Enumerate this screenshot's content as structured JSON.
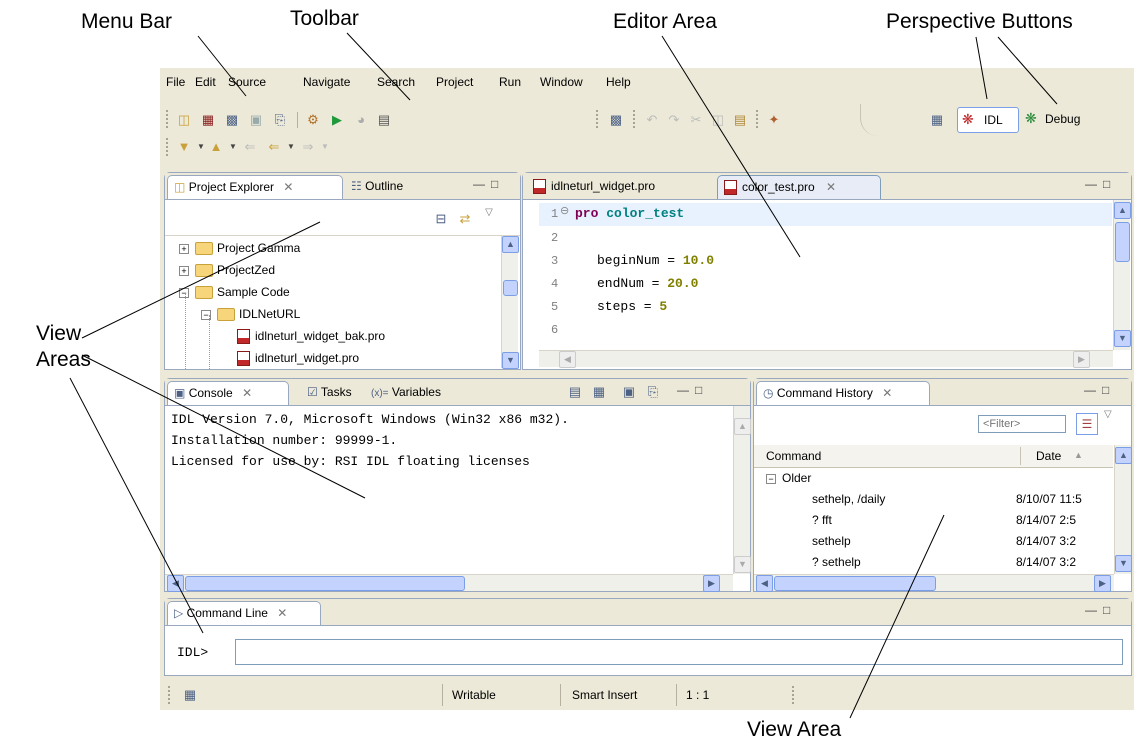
{
  "callouts": {
    "menu_bar": "Menu Bar",
    "toolbar": "Toolbar",
    "editor_area": "Editor Area",
    "perspective_buttons": "Perspective Buttons",
    "view_areas_line1": "View",
    "view_areas_line2": "Areas",
    "view_area": "View Area"
  },
  "menu": [
    "File",
    "Edit",
    "Source",
    "Navigate",
    "Search",
    "Project",
    "Run",
    "Window",
    "Help"
  ],
  "perspectives": {
    "idl": "IDL",
    "debug": "Debug"
  },
  "project_explorer": {
    "tabs": {
      "explorer": "Project Explorer",
      "outline": "Outline"
    },
    "tree": [
      {
        "label": "Project Gamma",
        "expander": "+"
      },
      {
        "label": "ProjectZed",
        "expander": "+"
      },
      {
        "label": "Sample Code",
        "expander": "−"
      },
      {
        "label": "IDLNetURL",
        "expander": "−"
      },
      {
        "label": "idlneturl_widget_bak.pro"
      },
      {
        "label": "idlneturl_widget.pro"
      }
    ]
  },
  "editor": {
    "tabs": {
      "tab1": "idlneturl_widget.pro",
      "tab2": "color_test.pro"
    },
    "lines": [
      {
        "num": "1",
        "kw": "pro",
        "rest": "color_test"
      },
      {
        "num": "2"
      },
      {
        "num": "3",
        "text": "beginNum = ",
        "val": "10.0"
      },
      {
        "num": "4",
        "text": "endNum = ",
        "val": "20.0"
      },
      {
        "num": "5",
        "text": "steps = ",
        "val": "5"
      },
      {
        "num": "6"
      }
    ]
  },
  "console": {
    "tabs": {
      "console": "Console",
      "tasks": "Tasks",
      "variables": "Variables"
    },
    "lines": [
      "IDL Version 7.0, Microsoft Windows (Win32 x86 m32).",
      "Installation number: 99999-1.",
      "Licensed for use by: RSI IDL floating licenses"
    ]
  },
  "history": {
    "tab": "Command History",
    "filter_placeholder": "<Filter>",
    "columns": {
      "command": "Command",
      "date": "Date"
    },
    "group": "Older",
    "rows": [
      {
        "command": "sethelp, /daily",
        "date": "8/10/07 11:5"
      },
      {
        "command": "? fft",
        "date": "8/14/07 2:5"
      },
      {
        "command": "sethelp",
        "date": "8/14/07 3:2"
      },
      {
        "command": "? sethelp",
        "date": "8/14/07 3:2"
      }
    ]
  },
  "command_line": {
    "tab": "Command Line",
    "prompt": "IDL>"
  },
  "status": {
    "writable": "Writable",
    "insert_mode": "Smart Insert",
    "position": "1 : 1"
  },
  "colors": {
    "keyword": "#7f0055",
    "name": "#008080",
    "number": "#808000",
    "accent": "#7b9ee6"
  }
}
